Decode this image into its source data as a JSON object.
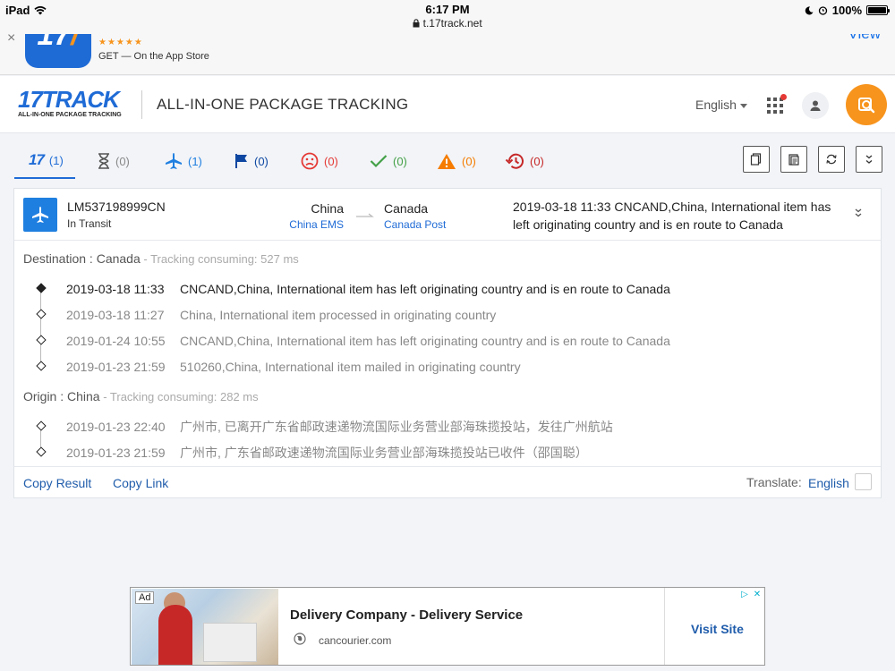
{
  "statusbar": {
    "device": "iPad",
    "time": "6:17 PM",
    "url": "t.17track.net",
    "battery": "100%"
  },
  "app_banner": {
    "close": "×",
    "stars": "★★★★★",
    "get_label": "GET — On the App Store",
    "view_label": "View"
  },
  "header": {
    "logo_main": "17TRACK",
    "logo_sub": "ALL-IN-ONE PACKAGE TRACKING",
    "title": "ALL-IN-ONE PACKAGE TRACKING",
    "language": "English"
  },
  "tabs": [
    {
      "icon": "17",
      "label": "(1)",
      "color": "#1f6bd6"
    },
    {
      "icon": "hourglass",
      "label": "(0)",
      "color": "#888888"
    },
    {
      "icon": "plane",
      "label": "(1)",
      "color": "#1f7fe0"
    },
    {
      "icon": "flag",
      "label": "(0)",
      "color": "#0d47a1"
    },
    {
      "icon": "sad-face",
      "label": "(0)",
      "color": "#e53935"
    },
    {
      "icon": "check",
      "label": "(0)",
      "color": "#43a047"
    },
    {
      "icon": "warning",
      "label": "(0)",
      "color": "#f57c00"
    },
    {
      "icon": "history",
      "label": "(0)",
      "color": "#c62828"
    }
  ],
  "tracking": {
    "number": "LM537198999CN",
    "status": "In Transit",
    "from_country": "China",
    "from_carrier": "China EMS",
    "to_country": "Canada",
    "to_carrier": "Canada Post",
    "latest_event": "2019-03-18 11:33  CNCAND,China, International item has left originating country and is en route to Canada",
    "destination_label": "Destination : Canada",
    "destination_consuming": " - Tracking consuming: 527 ms",
    "destination_events": [
      {
        "time": "2019-03-18 11:33",
        "desc": "CNCAND,China, International item has left originating country and is en route to Canada"
      },
      {
        "time": "2019-03-18 11:27",
        "desc": "China, International item processed in originating country"
      },
      {
        "time": "2019-01-24 10:55",
        "desc": "CNCAND,China, International item has left originating country and is en route to Canada"
      },
      {
        "time": "2019-01-23 21:59",
        "desc": "510260,China, International item mailed in originating country"
      }
    ],
    "origin_label": "Origin : China",
    "origin_consuming": " - Tracking consuming: 282 ms",
    "origin_events": [
      {
        "time": "2019-01-23 22:40",
        "desc": "广州市, 已离开广东省邮政速递物流国际业务营业部海珠揽投站，发往广州航站"
      },
      {
        "time": "2019-01-23 21:59",
        "desc": "广州市, 广东省邮政速递物流国际业务营业部海珠揽投站已收件（邵国聪）"
      }
    ]
  },
  "footer": {
    "copy_result": "Copy Result",
    "copy_link": "Copy Link",
    "translate_label": "Translate:",
    "translate_lang": "English"
  },
  "ad": {
    "badge": "Ad",
    "title": "Delivery Company - Delivery Service",
    "url": "cancourier.com",
    "cta": "Visit Site"
  },
  "colors": {
    "brand_blue": "#1f6bd6",
    "brand_orange": "#f7941d",
    "link": "#1f5cab"
  }
}
